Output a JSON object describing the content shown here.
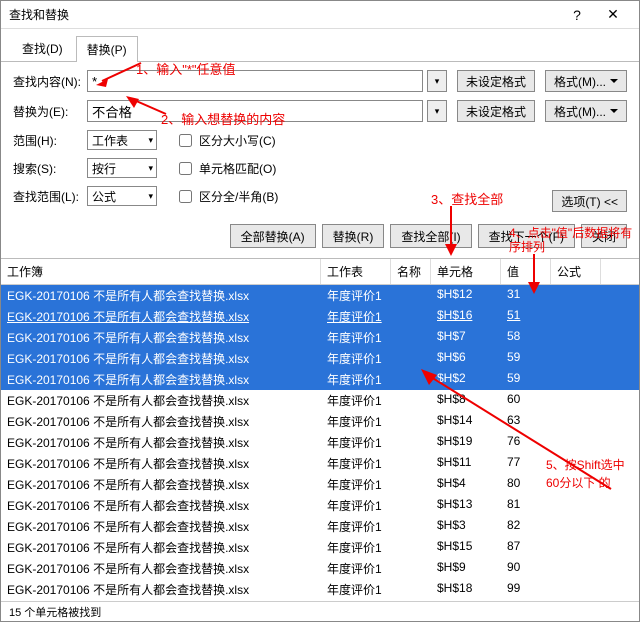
{
  "window": {
    "title": "查找和替换"
  },
  "tabs": {
    "find": "查找(D)",
    "replace": "替换(P)"
  },
  "form": {
    "find_label": "查找内容(N):",
    "find_value": "*",
    "replace_label": "替换为(E):",
    "replace_value": "不合格",
    "no_format": "未设定格式",
    "format_btn": "格式(M)...",
    "range_label": "范围(H):",
    "range_value": "工作表",
    "search_label": "搜索(S):",
    "search_value": "按行",
    "lookin_label": "查找范围(L):",
    "lookin_value": "公式",
    "checks": {
      "case": "区分大小写(C)",
      "whole": "单元格匹配(O)",
      "width": "区分全/半角(B)"
    },
    "options_btn": "选项(T) <<"
  },
  "buttons": {
    "replace_all": "全部替换(A)",
    "replace": "替换(R)",
    "find_all": "查找全部(I)",
    "find_next": "查找下一个(F)",
    "close": "关闭"
  },
  "table": {
    "headers": [
      "工作簿",
      "工作表",
      "名称",
      "单元格",
      "值",
      "公式"
    ],
    "rows": [
      {
        "wb": "EGK-20170106 不是所有人都会查找替换.xlsx",
        "sh": "年度评价1",
        "nm": "",
        "cell": "$H$12",
        "val": "31",
        "sel": true
      },
      {
        "wb": "EGK-20170106 不是所有人都会查找替换.xlsx",
        "sh": "年度评价1",
        "nm": "",
        "cell": "$H$16",
        "val": "51",
        "sel": true,
        "u": true
      },
      {
        "wb": "EGK-20170106 不是所有人都会查找替换.xlsx",
        "sh": "年度评价1",
        "nm": "",
        "cell": "$H$7",
        "val": "58",
        "sel": true
      },
      {
        "wb": "EGK-20170106 不是所有人都会查找替换.xlsx",
        "sh": "年度评价1",
        "nm": "",
        "cell": "$H$6",
        "val": "59",
        "sel": true
      },
      {
        "wb": "EGK-20170106 不是所有人都会查找替换.xlsx",
        "sh": "年度评价1",
        "nm": "",
        "cell": "$H$2",
        "val": "59",
        "sel": true
      },
      {
        "wb": "EGK-20170106 不是所有人都会查找替换.xlsx",
        "sh": "年度评价1",
        "nm": "",
        "cell": "$H$8",
        "val": "60"
      },
      {
        "wb": "EGK-20170106 不是所有人都会查找替换.xlsx",
        "sh": "年度评价1",
        "nm": "",
        "cell": "$H$14",
        "val": "63"
      },
      {
        "wb": "EGK-20170106 不是所有人都会查找替换.xlsx",
        "sh": "年度评价1",
        "nm": "",
        "cell": "$H$19",
        "val": "76"
      },
      {
        "wb": "EGK-20170106 不是所有人都会查找替换.xlsx",
        "sh": "年度评价1",
        "nm": "",
        "cell": "$H$11",
        "val": "77"
      },
      {
        "wb": "EGK-20170106 不是所有人都会查找替换.xlsx",
        "sh": "年度评价1",
        "nm": "",
        "cell": "$H$4",
        "val": "80"
      },
      {
        "wb": "EGK-20170106 不是所有人都会查找替换.xlsx",
        "sh": "年度评价1",
        "nm": "",
        "cell": "$H$13",
        "val": "81"
      },
      {
        "wb": "EGK-20170106 不是所有人都会查找替换.xlsx",
        "sh": "年度评价1",
        "nm": "",
        "cell": "$H$3",
        "val": "82"
      },
      {
        "wb": "EGK-20170106 不是所有人都会查找替换.xlsx",
        "sh": "年度评价1",
        "nm": "",
        "cell": "$H$15",
        "val": "87"
      },
      {
        "wb": "EGK-20170106 不是所有人都会查找替换.xlsx",
        "sh": "年度评价1",
        "nm": "",
        "cell": "$H$9",
        "val": "90"
      },
      {
        "wb": "EGK-20170106 不是所有人都会查找替换.xlsx",
        "sh": "年度评价1",
        "nm": "",
        "cell": "$H$18",
        "val": "99"
      }
    ]
  },
  "status": "15 个单元格被找到",
  "annotations": {
    "a1": "1、输入\"*\"任意值",
    "a2": "2、输入想替换的内容",
    "a3": "3、查找全部",
    "a4": "4、点击\"值\"后数据将有序排列",
    "a5a": "5、按Shift选中",
    "a5b": "60分以下 的"
  }
}
